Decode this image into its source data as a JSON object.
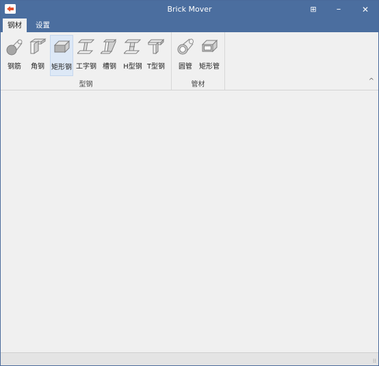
{
  "window": {
    "title": "Brick Mover"
  },
  "titlebar_buttons": {
    "restore": "⊞",
    "minimize": "–",
    "close": "✕"
  },
  "tabs": [
    {
      "label": "钢材",
      "active": true
    },
    {
      "label": "设置",
      "active": false
    }
  ],
  "ribbon": {
    "groups": [
      {
        "label": "型钢",
        "items": [
          {
            "label": "钢筋",
            "icon": "rebar-icon"
          },
          {
            "label": "角钢",
            "icon": "angle-steel-icon"
          },
          {
            "label": "矩形钢",
            "icon": "rect-steel-icon",
            "selected": true
          },
          {
            "label": "工字钢",
            "icon": "i-beam-icon"
          },
          {
            "label": "槽钢",
            "icon": "channel-steel-icon"
          },
          {
            "label": "H型钢",
            "icon": "h-beam-icon"
          },
          {
            "label": "T型钢",
            "icon": "t-beam-icon"
          }
        ]
      },
      {
        "label": "管材",
        "items": [
          {
            "label": "圆管",
            "icon": "round-tube-icon"
          },
          {
            "label": "矩形管",
            "icon": "rect-tube-icon"
          }
        ]
      }
    ],
    "collapse_glyph": "^"
  },
  "colors": {
    "titlebar": "#4b6e9f",
    "ribbon_bg": "#f0f0f0",
    "selected_bg": "#dde8f6",
    "icon_gray": "#9a9a9a"
  }
}
